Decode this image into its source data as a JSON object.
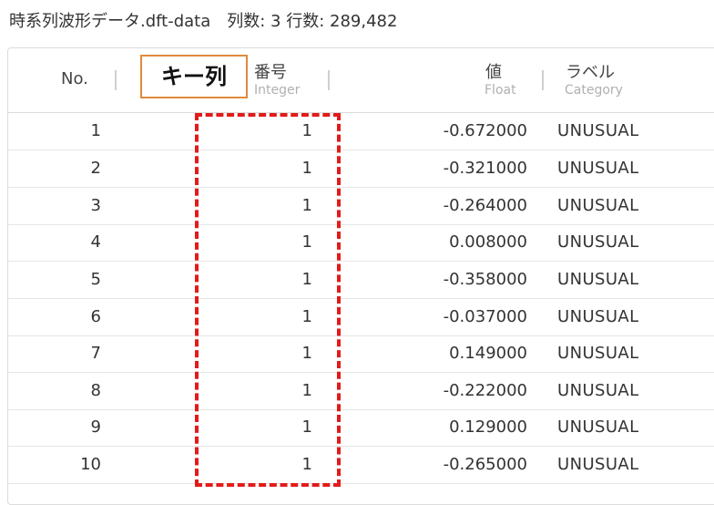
{
  "header": {
    "title": "時系列波形データ.dft-data",
    "stats": "列数: 3 行数: 289,482"
  },
  "columns": [
    {
      "label": "No.",
      "type": ""
    },
    {
      "label": "番号",
      "type": "Integer"
    },
    {
      "label": "値",
      "type": "Float"
    },
    {
      "label": "ラベル",
      "type": "Category"
    }
  ],
  "rows": [
    {
      "no": "1",
      "num": "1",
      "val": "-0.672000",
      "label": "UNUSUAL"
    },
    {
      "no": "2",
      "num": "1",
      "val": "-0.321000",
      "label": "UNUSUAL"
    },
    {
      "no": "3",
      "num": "1",
      "val": "-0.264000",
      "label": "UNUSUAL"
    },
    {
      "no": "4",
      "num": "1",
      "val": "0.008000",
      "label": "UNUSUAL"
    },
    {
      "no": "5",
      "num": "1",
      "val": "-0.358000",
      "label": "UNUSUAL"
    },
    {
      "no": "6",
      "num": "1",
      "val": "-0.037000",
      "label": "UNUSUAL"
    },
    {
      "no": "7",
      "num": "1",
      "val": "0.149000",
      "label": "UNUSUAL"
    },
    {
      "no": "8",
      "num": "1",
      "val": "-0.222000",
      "label": "UNUSUAL"
    },
    {
      "no": "9",
      "num": "1",
      "val": "0.129000",
      "label": "UNUSUAL"
    },
    {
      "no": "10",
      "num": "1",
      "val": "-0.265000",
      "label": "UNUSUAL"
    }
  ],
  "annotation": {
    "key_label": "キー列"
  },
  "colors": {
    "callout_border": "#e08a3c",
    "highlight_dash": "#e31a1a"
  }
}
